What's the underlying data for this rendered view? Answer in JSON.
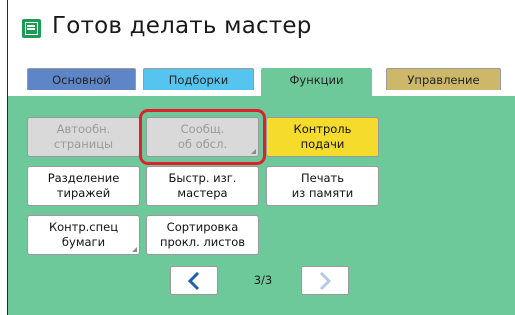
{
  "header": {
    "title": "Готов делать мастер",
    "icon": "master-document-icon"
  },
  "tabs": [
    {
      "label": "Основной",
      "color": "#5e86c6"
    },
    {
      "label": "Подборки",
      "color": "#55c4ee"
    },
    {
      "label": "Функции",
      "color": "#6ec99a",
      "active": true
    },
    {
      "label": "Управление",
      "color": "#cdb86a"
    }
  ],
  "buttons": [
    {
      "label": "Автообн.\nстраницы",
      "state": "disabled"
    },
    {
      "label": "Сообщ.\nоб обсл.",
      "state": "disabled",
      "highlighted": true
    },
    {
      "label": "Контроль\nподачи",
      "state": "active",
      "color": "#f5dc2c"
    },
    {
      "label": "Разделение\nтиражей",
      "state": "enabled"
    },
    {
      "label": "Быстр. изг.\nмастера",
      "state": "enabled"
    },
    {
      "label": "Печать\nиз памяти",
      "state": "enabled"
    },
    {
      "label": "Контр.спец\nбумаги",
      "state": "enabled"
    },
    {
      "label": "Сортировка\nпрокл. листов",
      "state": "enabled"
    }
  ],
  "pagination": {
    "page": "3/3",
    "prev_icon": "chevron-left-icon",
    "next_icon": "chevron-right-icon",
    "next_enabled": false
  },
  "colors": {
    "panel": "#6ec99a",
    "highlight": "#e0202e",
    "arrow_enabled": "#1f5fae",
    "arrow_disabled": "#b7c9e8"
  }
}
